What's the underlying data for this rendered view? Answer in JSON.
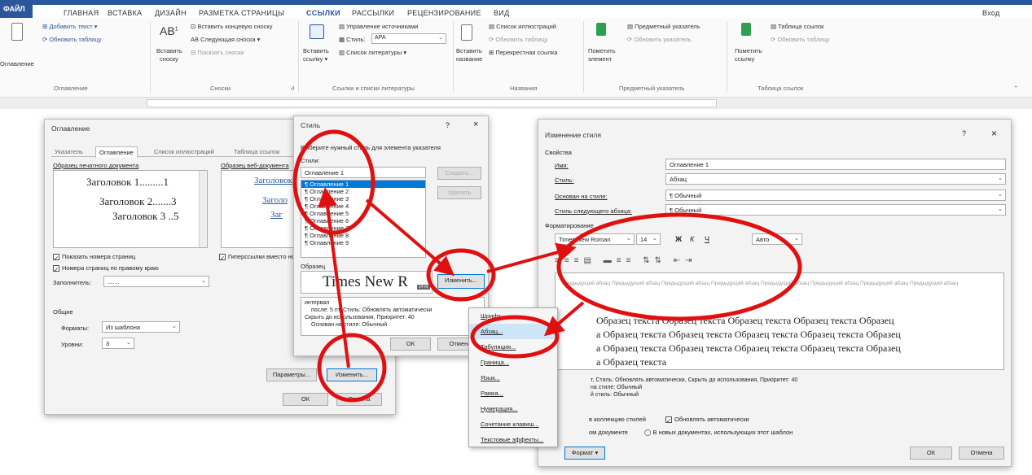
{
  "menu": {
    "file": "ФАЙЛ",
    "tabs": [
      "ГЛАВНАЯ",
      "ВСТАВКА",
      "ДИЗАЙН",
      "РАЗМЕТКА СТРАНИЦЫ",
      "ССЫЛКИ",
      "РАССЫЛКИ",
      "РЕЦЕНЗИРОВАНИЕ",
      "ВИД"
    ],
    "signin": "Вход"
  },
  "ribbon": {
    "toc": {
      "big": "Оглавление",
      "add": "Добавить текст",
      "update": "Обновить таблицу",
      "group": "Оглавление"
    },
    "footnotes": {
      "big1": "Вставить",
      "big2": "сноску",
      "endnote": "Вставить концевую сноску",
      "next": "Следующая сноска",
      "show": "Показать сноски",
      "group": "Сноски"
    },
    "citations": {
      "big1": "Вставить",
      "big2": "ссылку",
      "manage": "Управление источниками",
      "style_label": "Стиль:",
      "style_value": "APA",
      "biblio": "Список литературы",
      "group": "Ссылки и списки литературы"
    },
    "captions": {
      "big1": "Вставить",
      "big2": "название",
      "figures": "Список иллюстраций",
      "update": "Обновить таблицу",
      "cross": "Перекрестная ссылка",
      "group": "Названия"
    },
    "index": {
      "big1": "Пометить",
      "big2": "элемент",
      "insert": "Предметный указатель",
      "update": "Обновить указатель",
      "group": "Предметный указатель"
    },
    "authorities": {
      "big1": "Пометить",
      "big2": "ссылку",
      "insert": "Таблица ссылок",
      "update": "Обновить таблицу",
      "group": "Таблица ссылок"
    }
  },
  "toc_dialog": {
    "title": "Оглавление",
    "tabs": [
      "Указатель",
      "Оглавление",
      "Список иллюстраций",
      "Таблица ссылок"
    ],
    "print_preview_label": "Образец печатного документа",
    "print_lines": [
      "Заголовок 1.........1",
      "Заголовок 2.......3",
      "Заголовок 3 ..5"
    ],
    "web_preview_label": "Образец веб-документа",
    "web_lines": [
      "Заголовок",
      "Заголо",
      "Заг"
    ],
    "show_numbers": "Показать номера страниц",
    "align_right": "Номера страниц по правому краю",
    "leader_label": "Заполнитель:",
    "leader_value": ".......",
    "hyperlinks": "Гиперссылки вместо номеров страниц",
    "general": "Общие",
    "formats_label": "Форматы:",
    "formats_value": "Из шаблона",
    "levels_label": "Уровни:",
    "levels_value": "3",
    "params_button": "Параметры...",
    "modify_button": "Изменить...",
    "ok": "ОК",
    "cancel": "Отмена"
  },
  "style_dialog": {
    "title": "Стиль",
    "help": "?",
    "close": "×",
    "prompt": "Выберите нужный стиль для элемента указателя",
    "styles_label": "Стили:",
    "current": "Оглавление 1",
    "items": [
      "Оглавление 1",
      "Оглавление 2",
      "Оглавление 3",
      "Оглавление 4",
      "Оглавление 5",
      "Оглавление 6",
      "Оглавление 7",
      "Оглавление 8",
      "Оглавление 9"
    ],
    "new_button": "Создать...",
    "delete_button": "Удалить",
    "sample_label": "Образец",
    "sample_text": "Times New R",
    "sample_size": "14 пт",
    "modify_button": "Изменить...",
    "desc1": "интервал",
    "desc2": "после: 5 пт, Стиль: Обновлять автоматически",
    "desc3": "Скрыть до использования, Приоритет: 40",
    "desc4": "Основан на стиле: Обычный",
    "ok": "ОК",
    "cancel": "Отмена"
  },
  "context_menu": {
    "items": [
      "Шрифт...",
      "Абзац...",
      "Табуляция...",
      "Граница...",
      "Язык...",
      "Рамка...",
      "Нумерация...",
      "Сочетание клавиш...",
      "Текстовые эффекты..."
    ]
  },
  "modify_dialog": {
    "title": "Изменение стиля",
    "help": "?",
    "close": "×",
    "props": "Свойства",
    "name_label": "Имя:",
    "name_value": "Оглавление 1",
    "type_label": "Стиль:",
    "type_value": "Абзац",
    "based_label": "Основан на стиле:",
    "based_value": "¶  Обычный",
    "next_label": "Стиль следующего абзаца:",
    "next_value": "¶  Обычный",
    "format_label": "Форматирование",
    "font": "Times New Roman",
    "size": "14",
    "bold": "Ж",
    "italic": "К",
    "underline": "Ч",
    "color": "Авто",
    "prev_para": "Предыдущий абзац Предыдущий абзац Предыдущий абзац Предыдущий абзац Предыдущий абзац Предыдущий абзац Предыдущий абзац Предыдущий абзац",
    "sample_lines": [
      "Образец текста Образец текста Образец текста Образец текста Образец",
      "а Образец текста Образец текста Образец текста Образец текста Образец",
      "а Образец текста Образец текста Образец текста Образец текста Образец",
      "а Образец текста"
    ],
    "desc1": "т, Стиль: Обновлять автоматически, Скрыть до использования, Приоритет: 40",
    "desc2": "на стиле: Обычный",
    "desc3": "й стиль: Обычный",
    "add_gallery": "в коллекцию стилей",
    "auto_update": "Обновлять автоматически",
    "only_doc": "ом документе",
    "new_docs": "В новых документах, использующих этот шаблон",
    "format_button": "Формат ▾",
    "ok": "ОК",
    "cancel": "Отмена"
  },
  "colors": {
    "accent": "#2b579a",
    "annotation": "#e01010"
  }
}
